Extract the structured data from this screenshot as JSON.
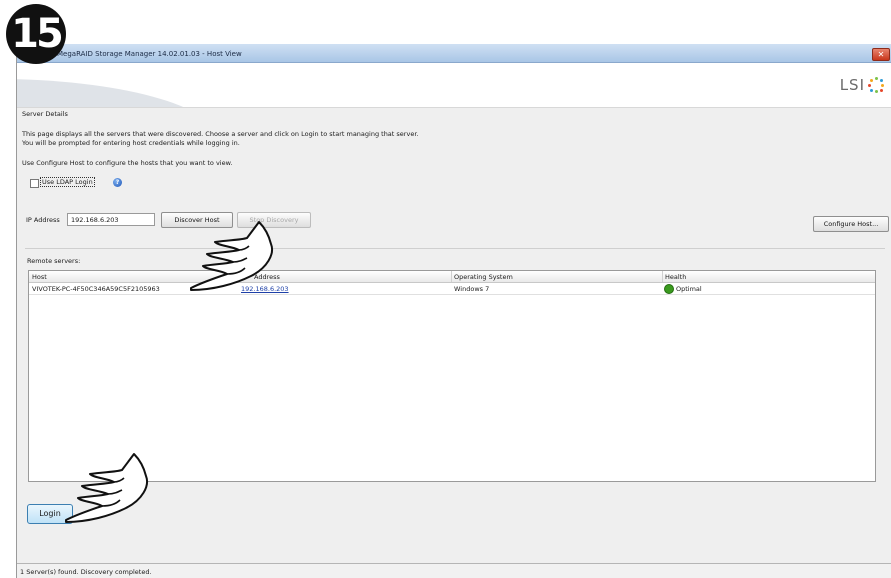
{
  "step": "15",
  "window": {
    "title": "MegaRAID Storage Manager 14.02.01.03 - Host View",
    "close_icon": "close-icon",
    "logo_text": "LSI"
  },
  "server_details": {
    "section_label": "Server Details",
    "description_line1": "This page displays all the servers that were discovered. Choose a server and click on Login to start managing that server.",
    "description_line2": "You will be prompted for entering host credentials while logging in.",
    "configure_hint": "Use Configure Host to configure the hosts that you want to view.",
    "ldap_label": "Use LDAP Login",
    "ldap_checked": false
  },
  "discovery": {
    "ip_label": "IP Address",
    "ip_value": "192.168.6.203",
    "discover_button": "Discover Host",
    "stop_button": "Stop Discovery",
    "configure_button": "Configure Host..."
  },
  "remote_servers": {
    "label": "Remote servers:",
    "columns": [
      "Host",
      "Address",
      "Operating System",
      "Health"
    ],
    "rows": [
      {
        "host": "VIVOTEK-PC-4F50C346A59C5F2105963",
        "address": "192.168.6.203",
        "os": "Windows 7",
        "health": "Optimal",
        "health_color": "#3a9a1e"
      }
    ]
  },
  "login_button": "Login",
  "status_text": "1 Server(s) found. Discovery completed.",
  "colors": {
    "title_bar": "#a9c6e6",
    "link": "#1e40a8",
    "login_border": "#3c7fb1"
  }
}
